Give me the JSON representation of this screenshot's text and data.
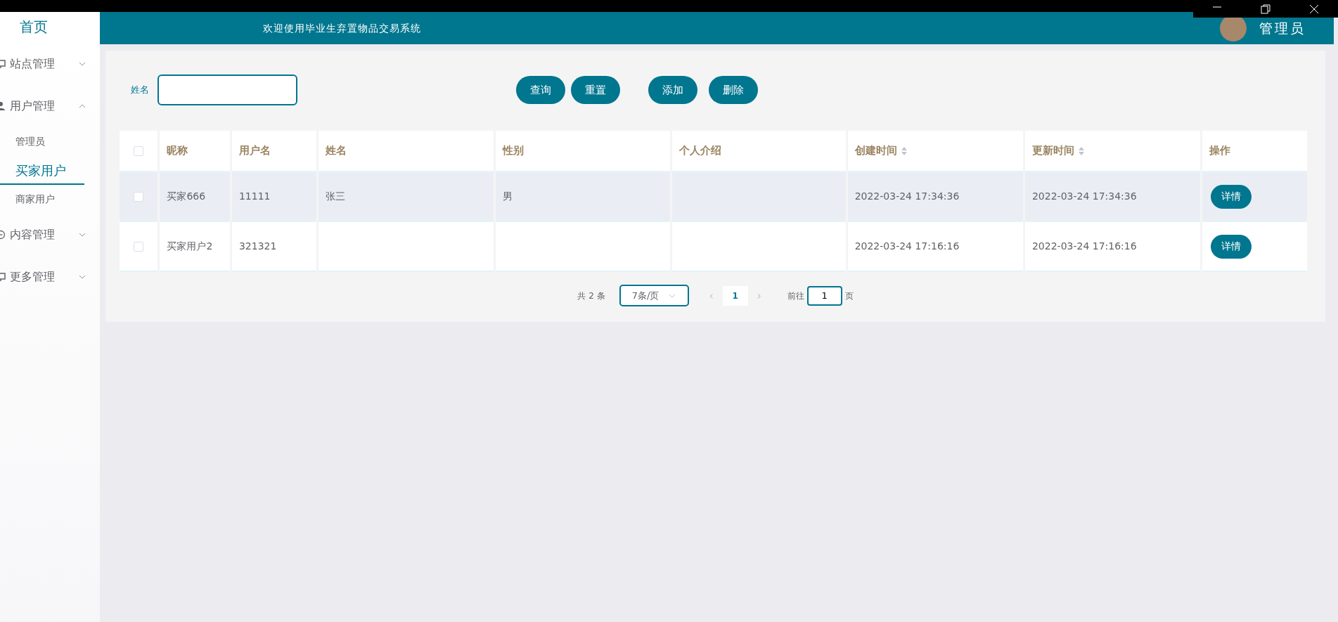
{
  "sidebar": {
    "home": "首页",
    "items": [
      {
        "label": "站点管理",
        "expanded": false
      },
      {
        "label": "用户管理",
        "expanded": true,
        "children": [
          {
            "label": "管理员",
            "selected": false
          },
          {
            "label": "买家用户",
            "selected": true
          },
          {
            "label": "商家用户",
            "selected": false
          }
        ]
      },
      {
        "label": "内容管理",
        "expanded": false
      },
      {
        "label": "更多管理",
        "expanded": false
      }
    ]
  },
  "header": {
    "title": "欢迎使用毕业生弃置物品交易系统",
    "user": {
      "name": "管理员"
    }
  },
  "search": {
    "fields": [
      {
        "label": "姓名"
      }
    ],
    "buttons": [
      "查询",
      "重置",
      "添加",
      "删除"
    ]
  },
  "table": {
    "select_all": {
      "checked": false
    },
    "columns": [
      {
        "label": "昵称",
        "sortable": false
      },
      {
        "label": "用户名",
        "sortable": false
      },
      {
        "label": "姓名",
        "sortable": false
      },
      {
        "label": "性别",
        "sortable": false
      },
      {
        "label": "个人介绍",
        "sortable": false
      },
      {
        "label": "创建时间",
        "sortable": true
      },
      {
        "label": "更新时间",
        "sortable": true
      },
      {
        "label": "操作",
        "sortable": false
      }
    ],
    "rows": [
      {
        "checked": false,
        "hovered": true,
        "cells": [
          "买家666",
          "11111",
          "张三",
          "男",
          "",
          "2022-03-24 17:34:36",
          "2022-03-24 17:34:36"
        ],
        "action": "详情"
      },
      {
        "checked": false,
        "hovered": false,
        "cells": [
          "买家用户2",
          "321321",
          "",
          "",
          "",
          "2022-03-24 17:16:16",
          "2022-03-24 17:16:16"
        ],
        "action": "详情"
      }
    ]
  },
  "pagination": {
    "total": "共 2 条",
    "page_size": "7条/页",
    "prev": "‹",
    "pages": [
      {
        "label": "1",
        "selected": true
      }
    ],
    "next": "›",
    "goto_label": "前往",
    "goto_value": "1",
    "goto_suffix": "页"
  }
}
